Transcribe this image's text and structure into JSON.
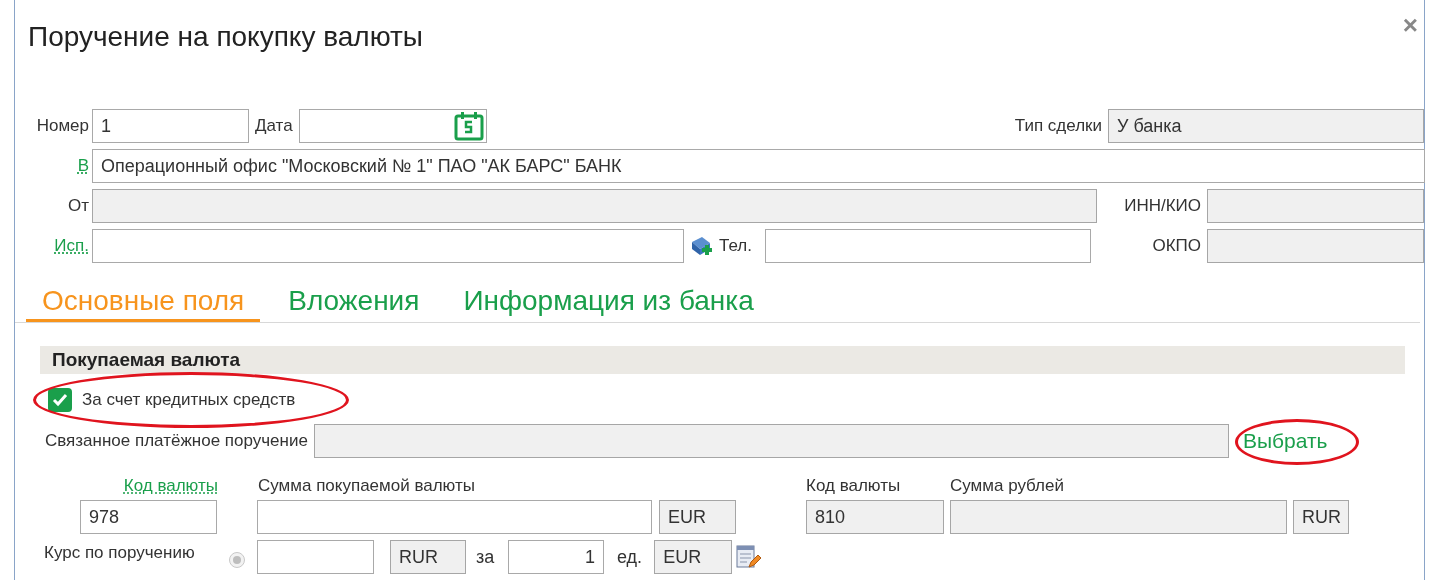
{
  "window": {
    "title": "Поручение на покупку валюты",
    "close": "×"
  },
  "number": {
    "label": "Номер",
    "value": "1",
    "disabled": false
  },
  "date": {
    "label": "Дата",
    "disabled": false
  },
  "deal_type": {
    "label": "Тип сделки",
    "value": "У банка",
    "disabled": true
  },
  "to": {
    "label": "В",
    "value": "Операционный офис \"Московский № 1\" ПАО \"АК БАРС\" БАНК",
    "disabled": false
  },
  "from": {
    "label": "От",
    "disabled": true
  },
  "inn": {
    "label": "ИНН/КИО",
    "disabled": true
  },
  "executor": {
    "label": "Исп.",
    "disabled": false
  },
  "phone": {
    "label": "Тел.",
    "disabled": false
  },
  "okpo": {
    "label": "ОКПО",
    "disabled": true
  },
  "tabs": [
    {
      "label": "Основные поля",
      "selected": true
    },
    {
      "label": "Вложения",
      "selected": false
    },
    {
      "label": "Информация из банка",
      "selected": false
    }
  ],
  "section": {
    "title": "Покупаемая валюта"
  },
  "credit_checkbox": {
    "label": "За счет кредитных средств",
    "checked": true,
    "circled": true
  },
  "linked_order": {
    "label": "Связанное платёжное поручение",
    "disabled": true,
    "link": "Выбрать",
    "circled": true
  },
  "buy": {
    "code_label": "Код валюты",
    "code": {
      "value": "978",
      "disabled": false
    },
    "amount_label": "Сумма покупаемой валюты",
    "amount": {
      "disabled": false
    },
    "currency": {
      "value": "EUR",
      "disabled": true
    }
  },
  "rub": {
    "code_label": "Код валюты",
    "code": {
      "value": "810",
      "disabled": true
    },
    "amount_label": "Сумма рублей",
    "amount": {
      "disabled": true
    },
    "currency": {
      "value": "RUR",
      "disabled": true
    }
  },
  "rate": {
    "label": "Курс по поручению",
    "radio": {
      "selected": true,
      "disabled": true
    },
    "value": {
      "disabled": false
    },
    "currency": {
      "value": "RUR",
      "disabled": true
    },
    "per": "за",
    "units": {
      "value": "1",
      "disabled": false
    },
    "units_label": "ед.",
    "unit_currency": {
      "value": "EUR",
      "disabled": true
    }
  }
}
